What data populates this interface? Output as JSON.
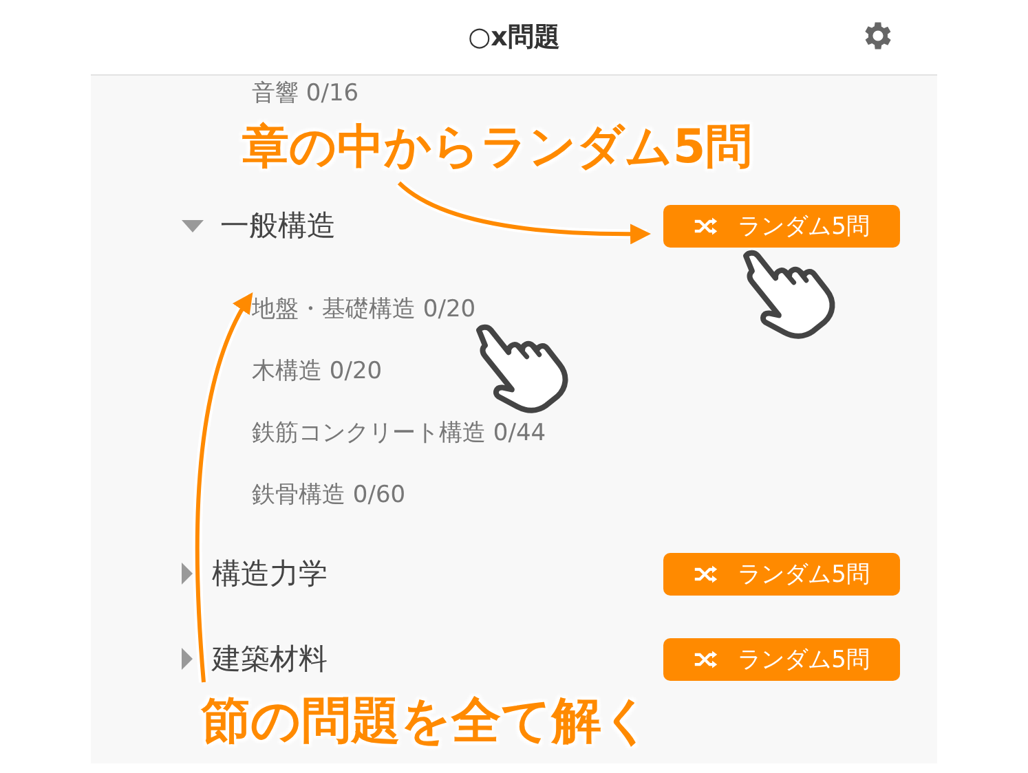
{
  "header": {
    "title": "○x問題"
  },
  "list": [
    {
      "kind": "section",
      "label": "音響 0/16"
    },
    {
      "kind": "chapter",
      "label": "一般構造",
      "expanded": true,
      "button": "ランダム5問",
      "children": [
        {
          "label": "地盤・基礎構造 0/20"
        },
        {
          "label": "木構造 0/20"
        },
        {
          "label": "鉄筋コンクリート構造 0/44"
        },
        {
          "label": "鉄骨構造 0/60"
        }
      ]
    },
    {
      "kind": "chapter",
      "label": "構造力学",
      "expanded": false,
      "button": "ランダム5問"
    },
    {
      "kind": "chapter",
      "label": "建築材料",
      "expanded": false,
      "button": "ランダム5問"
    }
  ],
  "annotations": [
    {
      "text": "章の中からランダム5問"
    },
    {
      "text": "節の問題を全て解く"
    }
  ]
}
